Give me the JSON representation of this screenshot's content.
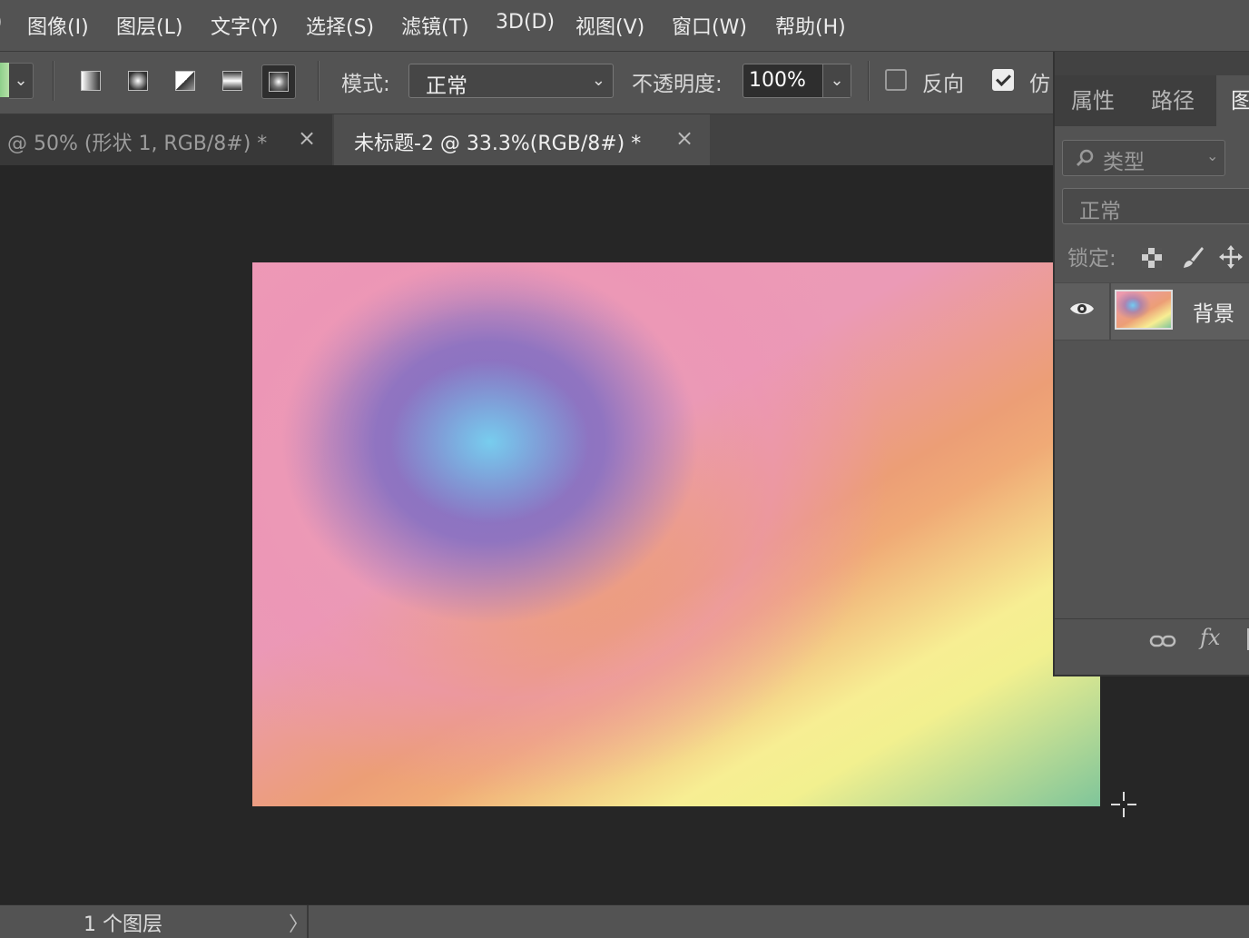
{
  "menu": {
    "items": [
      "图像(I)",
      "图层(L)",
      "文字(Y)",
      "选择(S)",
      "滤镜(T)",
      "3D(D)",
      "视图(V)",
      "窗口(W)",
      "帮助(H)"
    ]
  },
  "options": {
    "gradient_types": [
      "linear-gradient-icon",
      "radial-gradient-icon",
      "angle-gradient-icon",
      "reflected-gradient-icon",
      "diamond-gradient-icon"
    ],
    "active_gradient_type": "diamond-gradient-icon",
    "mode_label": "模式:",
    "mode_value": "正常",
    "opacity_label": "不透明度:",
    "opacity_value": "100%",
    "reverse_label": "反向",
    "reverse_checked": false,
    "dither_label": "仿",
    "dither_checked": true,
    "dropdown_glyph": "⌄"
  },
  "tabs": [
    {
      "label": ". @ 50% (形状 1, RGB/8#) *",
      "close": "×",
      "active": false
    },
    {
      "label": "未标题-2 @ 33.3%(RGB/8#) *",
      "close": "×",
      "active": true
    }
  ],
  "colors": {
    "canvas_pink": "#ee99b5",
    "canvas_purple": "#806ec3",
    "canvas_blue": "#78cdee",
    "canvas_orange": "#ec9e76",
    "canvas_yellow": "#f7ee93",
    "canvas_green": "#7fc59a"
  },
  "panel": {
    "tabs": [
      "属性",
      "路径",
      "图"
    ],
    "active_tab": 2,
    "filter_label": "类型",
    "blend_mode": "正常",
    "lock_label": "锁定:",
    "layers": [
      {
        "name": "背景",
        "visible": true
      }
    ],
    "fx_label": "fx"
  },
  "status": {
    "text": "1 个图层",
    "arrow": "〉"
  }
}
